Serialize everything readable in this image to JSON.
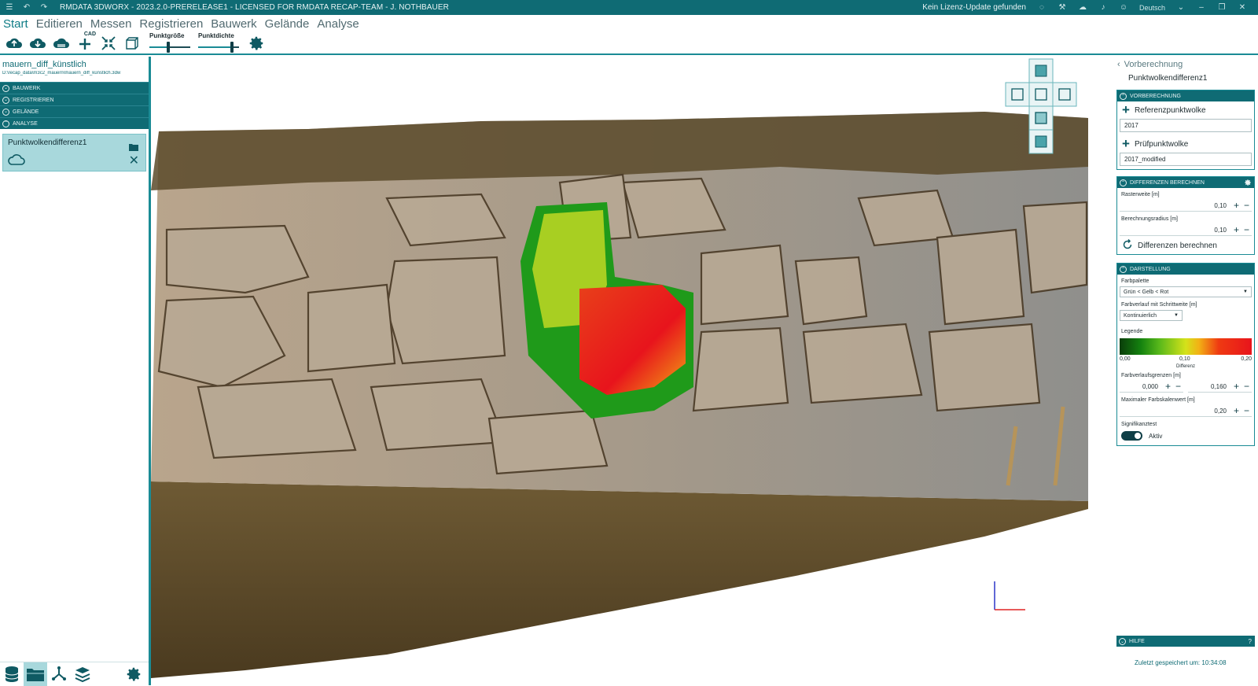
{
  "titlebar": {
    "title": "RMDATA 3DWORX - 2023.2.0-PRERELEASE1 - LICENSED FOR RMDATA RECAP-TEAM - J. NOTHBAUER",
    "license_status": "Kein Lizenz-Update gefunden",
    "language": "Deutsch"
  },
  "menu": {
    "items": [
      "Start",
      "Editieren",
      "Messen",
      "Registrieren",
      "Bauwerk",
      "Gelände",
      "Analyse"
    ],
    "active": "Start"
  },
  "toolbar": {
    "cad_label": "CAD",
    "punktgroesse_label": "Punktgröße",
    "punktdichte_label": "Punktdichte",
    "punktgroesse_value": 0.45,
    "punktdichte_value": 0.85
  },
  "project": {
    "name": "mauern_diff_künstlich",
    "path": "D:\\recap_data\\m3c2_mauern\\mauern_diff_künstlich.3dw"
  },
  "left_sections": [
    "BAUWERK",
    "REGISTRIEREN",
    "GELÄNDE",
    "ANALYSE"
  ],
  "analysis_item": {
    "title": "Punktwolkendifferenz1"
  },
  "right_panel": {
    "back_label": "Vorberechnung",
    "subtitle": "Punktwolkendifferenz1",
    "vorberechnung": {
      "header": "VORBERECHNUNG",
      "ref_label": "Referenzpunktwolke",
      "ref_value": "2017",
      "test_label": "Prüfpunktwolke",
      "test_value": "2017_modified"
    },
    "differenzen": {
      "header": "DIFFERENZEN BERECHNEN",
      "raster_label": "Rasterweite [m]",
      "raster_value": "0,10",
      "radius_label": "Berechnungsradius [m]",
      "radius_value": "0,10",
      "compute_label": "Differenzen berechnen"
    },
    "darstellung": {
      "header": "DARSTELLUNG",
      "palette_label": "Farbpalette",
      "palette_value": "Grün < Gelb < Rot",
      "verlauf_label": "Farbverlauf mit Schrittweite [m]",
      "verlauf_value": "Kontinuierlich",
      "legend_label": "Legende",
      "legend_ticks": [
        "0,00",
        "0,10",
        "0,20"
      ],
      "legend_caption": "Differenz",
      "grenzen_label": "Farbverlaufsgrenzen [m]",
      "grenzen_min": "0,000",
      "grenzen_max": "0,160",
      "max_label": "Maximaler Farbskalenwert [m]",
      "max_value": "0,20",
      "signif_label": "Signifikanztest",
      "signif_state": "Aktiv"
    },
    "help_header": "HILFE",
    "help_q": "?",
    "saved_text": "Zuletzt gespeichert um: 10:34:08"
  },
  "colors": {
    "teal_dark": "#0f6b74",
    "teal_accent": "#1a8b95",
    "card_bg": "#a8d8dc"
  }
}
